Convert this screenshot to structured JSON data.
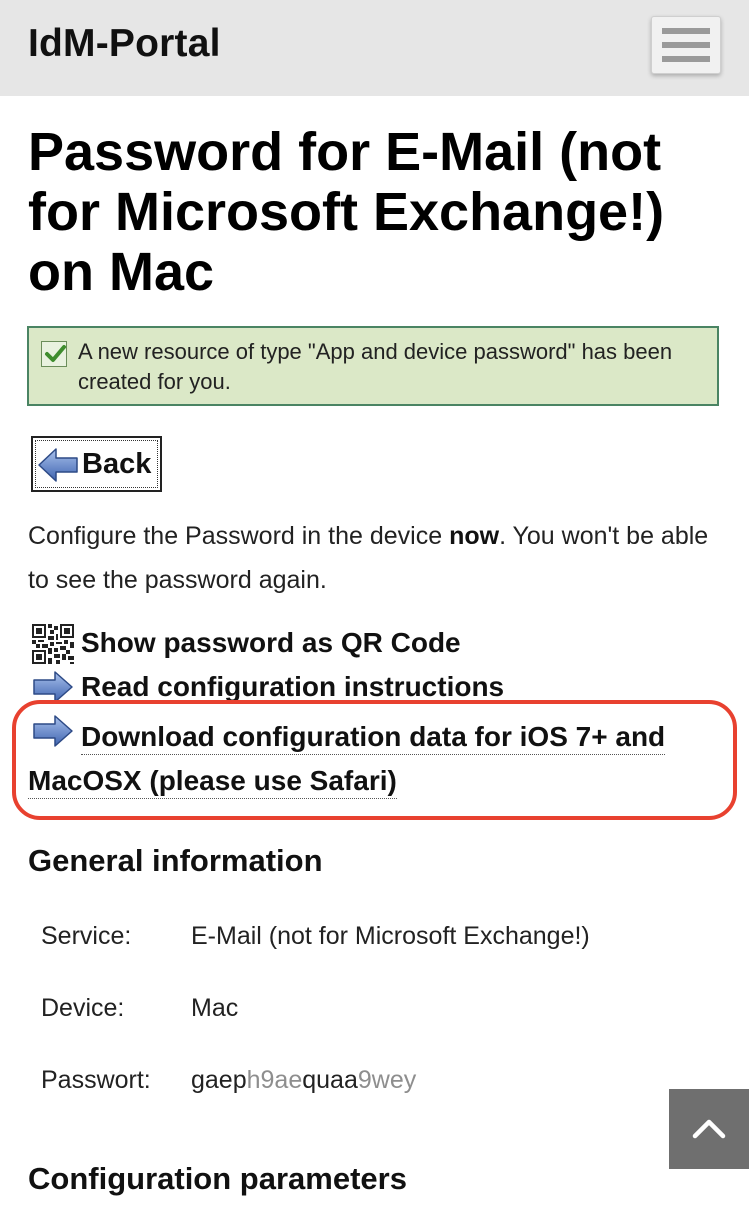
{
  "header": {
    "brand": "IdM-Portal",
    "menu_icon": "hamburger-menu-icon"
  },
  "page": {
    "title": "Password for E-Mail (not for Microsoft Exchange!) on Mac"
  },
  "notice": {
    "icon": "checkmark-icon",
    "message": "A new resource of type \"App and device password\" has been created for you."
  },
  "back_button": {
    "label": "Back",
    "icon": "arrow-left-icon"
  },
  "instructions": {
    "before": "Configure the Password in the device ",
    "emphasis": "now",
    "after": ". You won't be able to see the password again."
  },
  "actions": [
    {
      "label": "Show password as QR Code",
      "icon": "qr-code-icon"
    },
    {
      "label": "Read configuration instructions",
      "icon": "arrow-right-icon"
    },
    {
      "label": "Download configuration data for iOS 7+ and MacOSX (please use Safari)",
      "icon": "arrow-right-icon"
    }
  ],
  "general": {
    "heading": "General information",
    "rows": [
      {
        "key": "Service:",
        "value": "E-Mail (not for Microsoft Exchange!)"
      },
      {
        "key": "Device:",
        "value": "Mac"
      }
    ],
    "password": {
      "key": "Passwort:",
      "parts": [
        "gaep",
        "h9ae",
        "quaa",
        "9wey"
      ]
    }
  },
  "config": {
    "heading": "Configuration parameters"
  },
  "scroll_top_icon": "chevron-up-icon",
  "colors": {
    "header_bg": "#e6e6e6",
    "notice_bg": "#dbe8c7",
    "notice_border": "#4a8463",
    "highlight": "#e8412f",
    "arrow_blue": "#5b7fc4",
    "scroll_top_bg": "#6f6f6f"
  }
}
